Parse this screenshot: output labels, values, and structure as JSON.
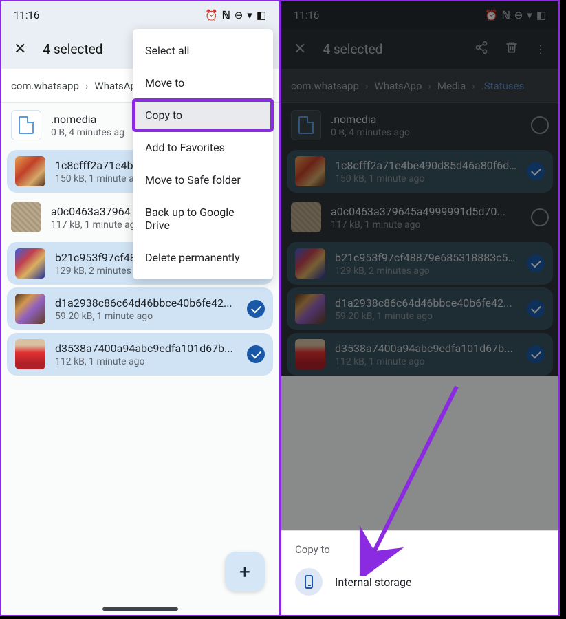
{
  "status": {
    "time": "11:16"
  },
  "header": {
    "selected_text": "4 selected"
  },
  "breadcrumb_left": [
    "com.whatsapp",
    "WhatsAp"
  ],
  "breadcrumb_right": [
    "com.whatsapp",
    "WhatsApp",
    "Media",
    ".Statuses"
  ],
  "menu": {
    "items": [
      "Select all",
      "Move to",
      "Copy to",
      "Add to Favorites",
      "Move to Safe folder",
      "Back up to Google Drive",
      "Delete permanently"
    ]
  },
  "files": [
    {
      "name": ".nomedia",
      "meta": "0 B, 4 minutes ago",
      "thumb": "doc",
      "selected": false
    },
    {
      "name": "1c8cfff2a71e4be490d85d46a80f6d...",
      "meta": "150 kB, 1 minute ago",
      "thumb": "img1",
      "selected": true
    },
    {
      "name": "a0c0463a379645a4999991d5d70...",
      "meta": "117 kB, 1 minute ago",
      "thumb": "img2",
      "selected": false
    },
    {
      "name": "b21c953f97cf48879e685318883c5c...",
      "meta": "129 kB, 2 minutes ago",
      "thumb": "img3",
      "selected": true
    },
    {
      "name": "d1a2938c86c64d46bbce40b6fe42...",
      "meta": "59.20 kB, 1 minute ago",
      "thumb": "img4",
      "selected": true
    },
    {
      "name": "d3538a7400a94abc9edfa101d67b...",
      "meta": "112 kB, 1 minute ago",
      "thumb": "img5",
      "selected": true
    }
  ],
  "files_left_trunc": [
    {
      "name": ".nomedia",
      "meta": "0 B, 4 minutes ag"
    },
    {
      "name": "1c8cfff2a71e4be",
      "meta": "150 kB, 1 minute a"
    },
    {
      "name": "a0c0463a37964",
      "meta": "117 kB, 1 minute ag"
    },
    {
      "name": "b21c953f97cf48879e685318883c5c...",
      "meta": "129 kB, 2 minutes ago"
    },
    {
      "name": "d1a2938c86c64d46bbce40b6fe42...",
      "meta": "59.20 kB, 1 minute ago"
    },
    {
      "name": "d3538a7400a94abc9edfa101d67b...",
      "meta": "112 kB, 1 minute ago"
    }
  ],
  "sheet": {
    "title": "Copy to",
    "option": "Internal storage"
  }
}
